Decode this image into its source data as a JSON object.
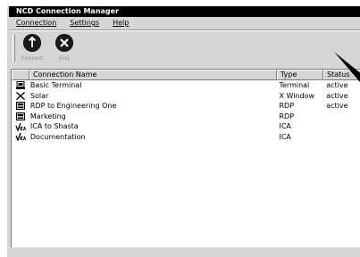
{
  "window": {
    "title": "NCD Connection Manager"
  },
  "menu": [
    {
      "label": "Connection"
    },
    {
      "label": "Settings"
    },
    {
      "label": "Help"
    }
  ],
  "toolbar": {
    "connect_label": "Connect",
    "end_label": "End"
  },
  "list": {
    "headers": {
      "name": "Connection Name",
      "type": "Type",
      "status": "Status"
    },
    "rows": [
      {
        "icon": "terminal-icon",
        "name": "Basic Terminal",
        "type": "Terminal",
        "status": "active"
      },
      {
        "icon": "x-window-icon",
        "name": "Solar",
        "type": "X Window",
        "status": "active"
      },
      {
        "icon": "rdp-icon",
        "name": "RDP to Engineering One",
        "type": "RDP",
        "status": "active"
      },
      {
        "icon": "rdp-icon",
        "name": "Marketing",
        "type": "RDP",
        "status": ""
      },
      {
        "icon": "ica-icon",
        "name": "ICA to Shasta",
        "type": "ICA",
        "status": ""
      },
      {
        "icon": "ica-icon",
        "name": "Documentation",
        "type": "ICA",
        "status": ""
      }
    ]
  }
}
